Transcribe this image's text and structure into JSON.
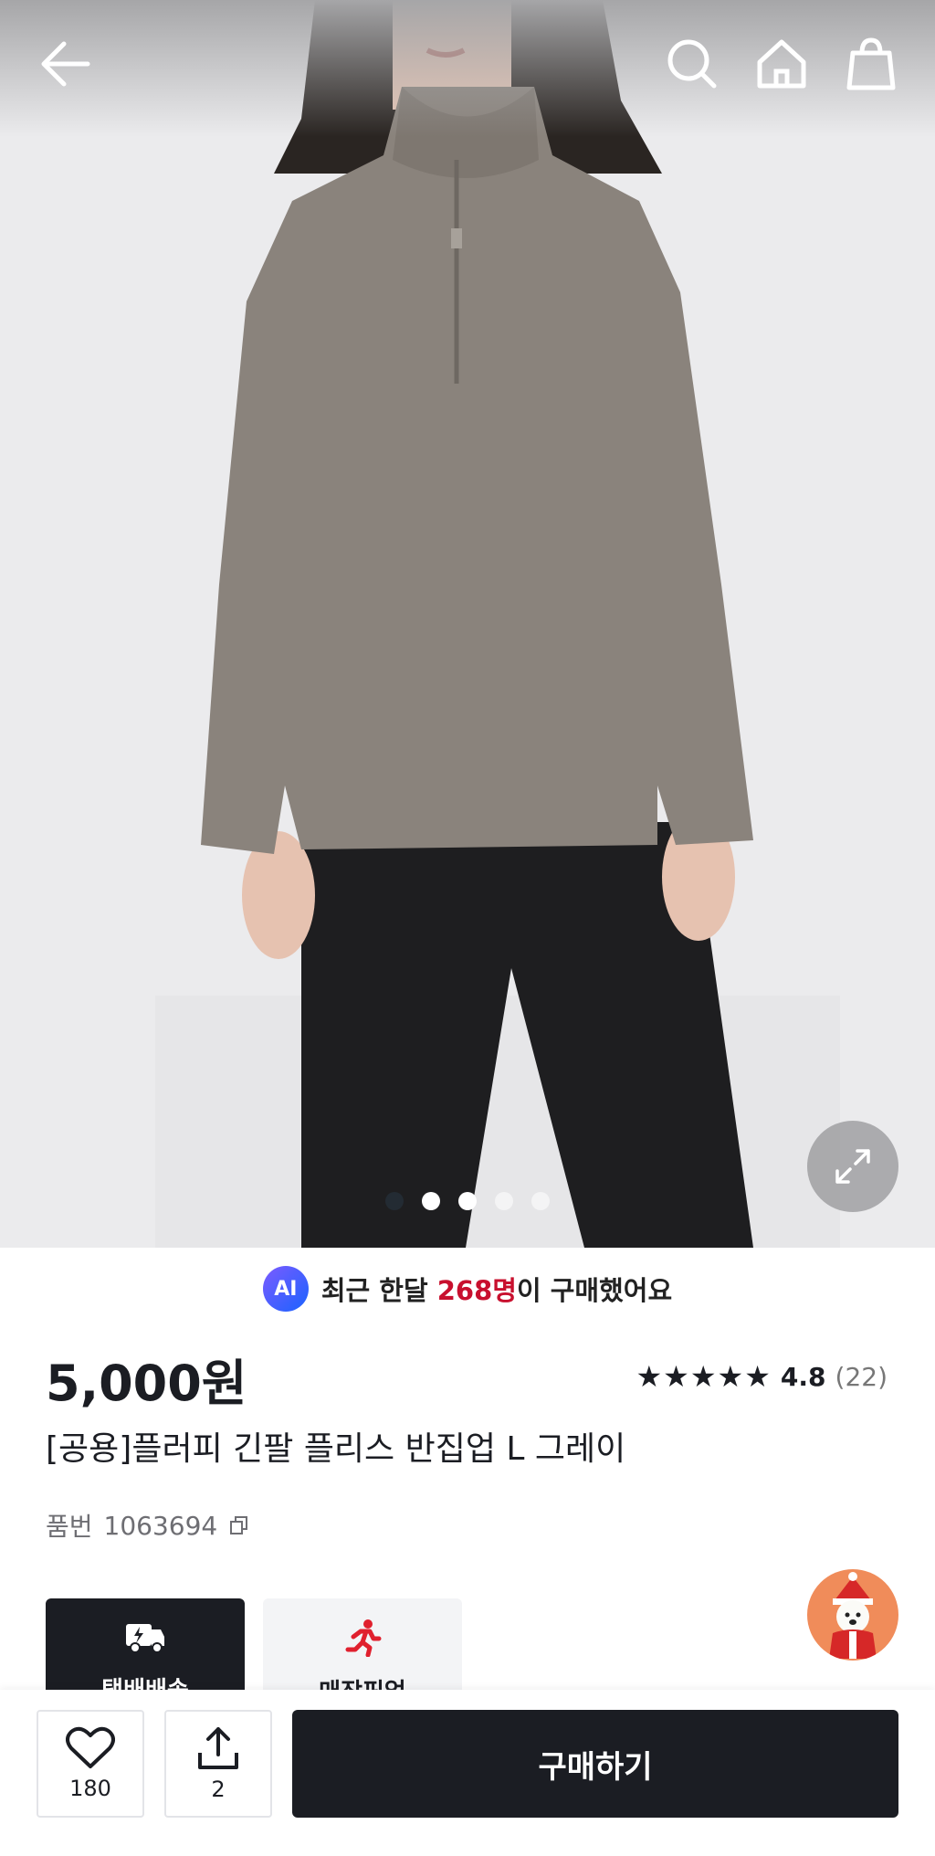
{
  "header": {
    "back_icon": "arrow-left-icon",
    "search_icon": "search-icon",
    "home_icon": "home-icon",
    "cart_icon": "shopping-bag-icon"
  },
  "gallery": {
    "image_alt": "플러피 긴팔 플리스 반집업 그레이 착용 이미지",
    "dots": 5,
    "active_dot": 2,
    "expand_icon": "expand-icon"
  },
  "ai_banner": {
    "badge": "AI",
    "prefix": "최근 한달 ",
    "count": "268명",
    "suffix": "이 구매했어요"
  },
  "product": {
    "price": "5,000원",
    "rating_stars": "★★★★★",
    "rating_score": "4.8",
    "rating_count": "(22)",
    "name": "[공용]플러피 긴팔 플리스 반집업 L 그레이",
    "sku_label": "품번",
    "sku_value": "1063694"
  },
  "delivery_options": [
    {
      "label": "택배배송",
      "icon": "delivery-truck-icon"
    },
    {
      "label": "매장픽업",
      "icon": "running-person-icon"
    }
  ],
  "bottom_bar": {
    "like_count": "180",
    "share_count": "2",
    "buy_label": "구매하기"
  },
  "colors": {
    "accent_red": "#c8102e",
    "dark": "#1b1d23"
  }
}
